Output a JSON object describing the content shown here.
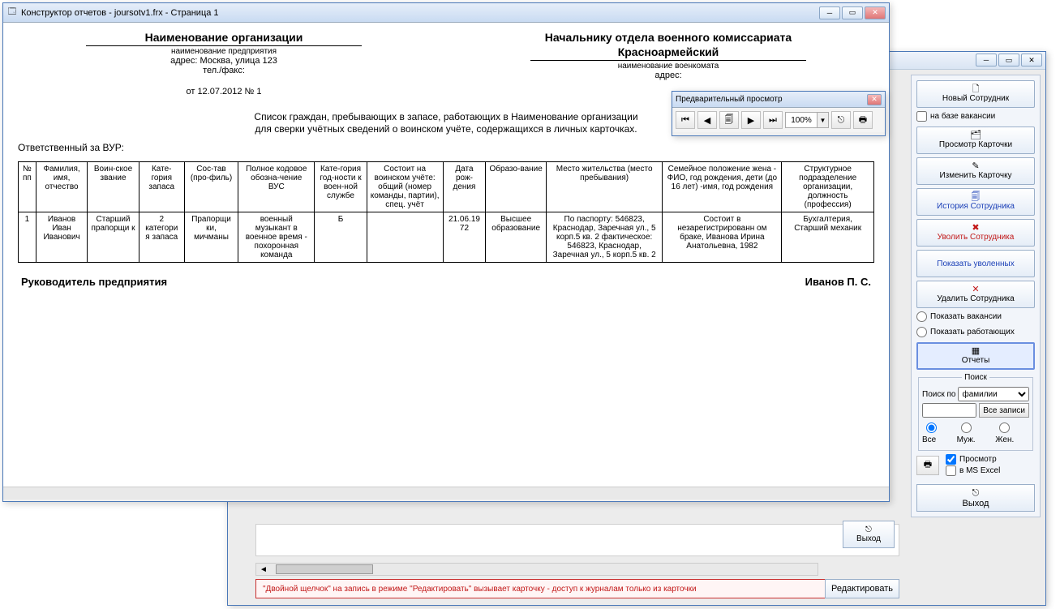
{
  "report_window": {
    "title": "Конструктор отчетов - joursotv1.frx - Страница 1"
  },
  "doc": {
    "org_heading": "Наименование организации",
    "org_sub": "наименование предприятия",
    "org_addr": "адрес: Москва, улица 123",
    "org_tel": "тел./факс:",
    "org_date": "от 12.07.2012   № 1",
    "dest_heading": "Начальнику отдела военного комиссариата",
    "dest_name": "Красноармейский",
    "dest_sub": "наименование военкомата",
    "dest_addr": "адрес:",
    "para1": "Список граждан, пребывающих в запасе, работающих в Наименование организации",
    "para2": "для сверки учётных сведений о воинском учёте, содержащихся в личных карточках.",
    "resp": "Ответственный за ВУР:",
    "sig_left": "Руководитель предприятия",
    "sig_right": "Иванов П. С."
  },
  "columns": [
    "№ пп",
    "Фамилия, имя, отчество",
    "Воин-ское звание",
    "Кате-гория запаса",
    "Сос-тав (про-филь)",
    "Полное кодовое обозна-чение ВУС",
    "Кате-гория год-ности к воен-ной службе",
    "Состоит на воинском учёте: общий (номер команды, партии), спец. учёт",
    "Дата рож-дения",
    "Образо-вание",
    "Место жительства (место пребывания)",
    "Семейное положение жена - ФИО, год рождения, дети (до 16 лет) -имя, год рождения",
    "Структурное подразделение организации, должность (профессия)"
  ],
  "row": {
    "num": "1",
    "fio": "Иванов Иван Иванович",
    "rank": "Старший прапорщи к",
    "cat": "2 категори я запаса",
    "comp": "Прапорщи ки, мичманы",
    "vus": "военный музыкант в военное время - похоронная команда",
    "godn": "Б",
    "uchet": "",
    "dob": "21.06.19 72",
    "edu": "Высшее образование",
    "addr": "По паспорту: 546823, Краснодар, Заречная ул., 5 корп.5 кв. 2 фактическое: 546823, Краснодар, Заречная ул., 5 корп.5 кв. 2",
    "fam": "Состоит в незарегистрированн ом браке, Иванова Ирина Анатольевна, 1982",
    "dept": "Бухгалтерия, Старший механик"
  },
  "preview": {
    "title": "Предварительный просмотр",
    "zoom": "100%"
  },
  "sidebar": {
    "new_emp": "Новый Сотрудник",
    "base_vac": "на базе вакансии",
    "view_card": "Просмотр Карточки",
    "edit_card": "Изменить Карточку",
    "history": "История Сотрудника",
    "fire": "Уволить Сотрудника",
    "show_fired": "Показать уволенных",
    "delete": "Удалить Сотрудника",
    "show_vac": "Показать вакансии",
    "show_work": "Показать работающих",
    "reports": "Отчеты",
    "search_title": "Поиск",
    "search_by": "Поиск по",
    "search_field": "фамилии",
    "all_rec": "Все записи",
    "r_all": "Все",
    "r_m": "Муж.",
    "r_f": "Жен.",
    "preview_chk": "Просмотр",
    "excel_chk": "в MS Excel",
    "exit": "Выход"
  },
  "bg": {
    "exit2": "Выход",
    "hint": "\"Двойной щелчок\" на запись в режиме \"Редактировать\" вызывает карточку  -  доступ к журналам только из карточки",
    "edit": "Редактировать"
  }
}
